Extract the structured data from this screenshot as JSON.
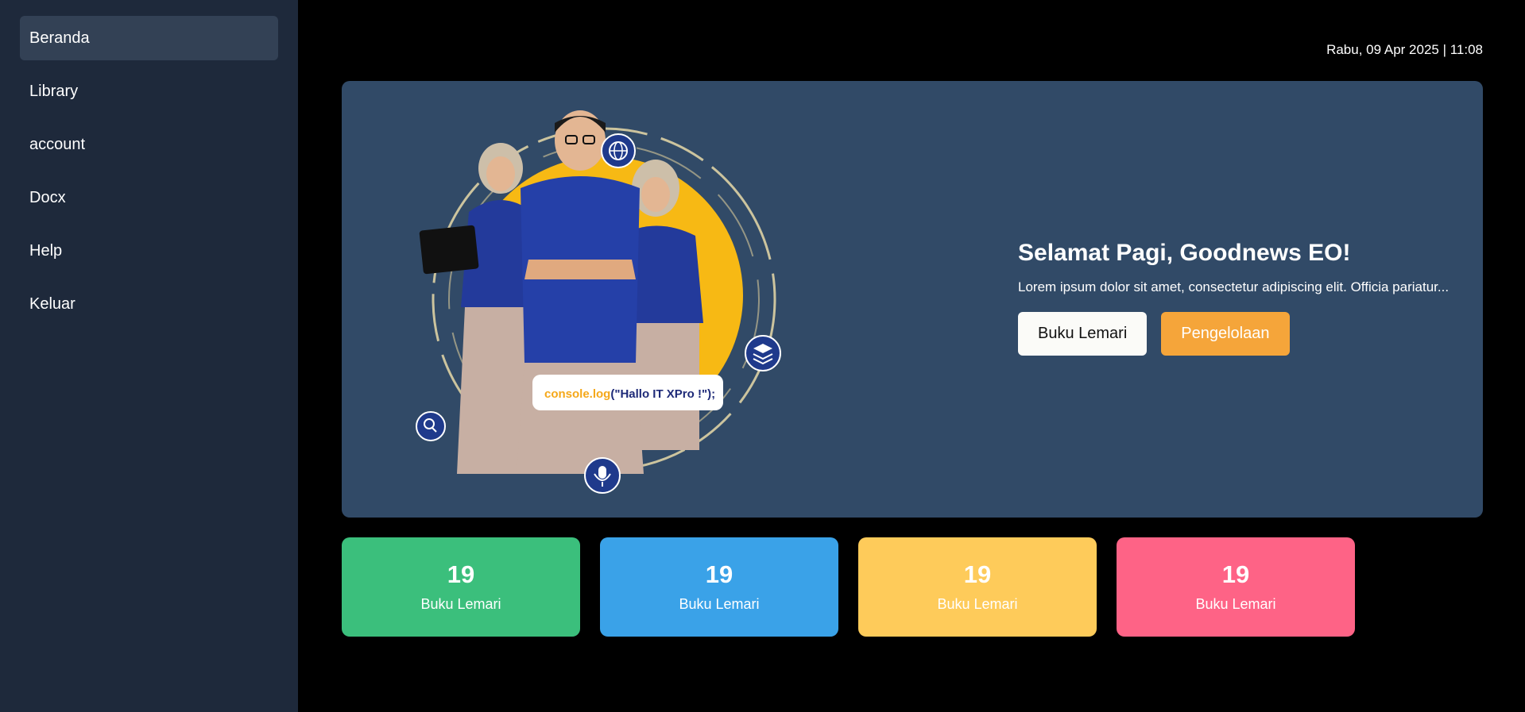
{
  "sidebar": {
    "items": [
      {
        "label": "Beranda",
        "active": true
      },
      {
        "label": "Library",
        "active": false
      },
      {
        "label": "account",
        "active": false
      },
      {
        "label": "Docx",
        "active": false
      },
      {
        "label": "Help",
        "active": false
      },
      {
        "label": "Keluar",
        "active": false
      }
    ]
  },
  "header": {
    "datetime": "Rabu, 09 Apr 2025 | 11:08"
  },
  "hero": {
    "title": "Selamat Pagi, Goodnews EO!",
    "description": "Lorem ipsum dolor sit amet, consectetur adipiscing elit. Officia pariatur...",
    "primary_button": "Buku Lemari",
    "secondary_button": "Pengelolaan",
    "illustration": {
      "code_prefix": "console.log",
      "code_rest": "(\"Hallo IT XPro !\");",
      "icons": [
        "globe-icon",
        "layers-icon",
        "microphone-icon",
        "search-icon"
      ]
    }
  },
  "stats": [
    {
      "value": "19",
      "label": "Buku Lemari",
      "color": "#3bbf7c"
    },
    {
      "value": "19",
      "label": "Buku Lemari",
      "color": "#3aa2e8"
    },
    {
      "value": "19",
      "label": "Buku Lemari",
      "color": "#fecb5a"
    },
    {
      "value": "19",
      "label": "Buku Lemari",
      "color": "#fe6386"
    }
  ],
  "colors": {
    "sidebar_bg": "#1e293b",
    "sidebar_active": "#334155",
    "hero_bg": "#314a67",
    "page_bg": "#000000",
    "accent_orange": "#f5a53a"
  }
}
